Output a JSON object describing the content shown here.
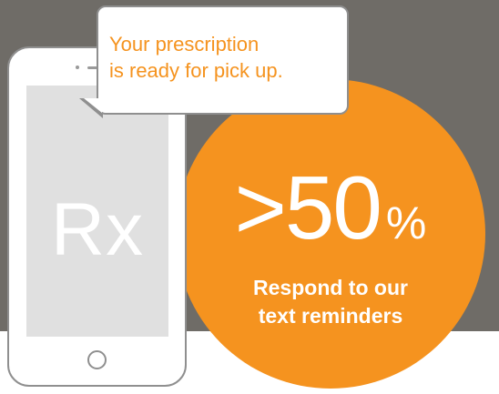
{
  "colors": {
    "background_dark": "#6f6c67",
    "accent_orange": "#f5931f",
    "phone_screen": "#e0e0e0",
    "outline_gray": "#8f8f8f"
  },
  "phone": {
    "screen_label": "Rx"
  },
  "bubble": {
    "line1": "Your prescription",
    "line2": "is ready for pick up."
  },
  "stat": {
    "number": ">50",
    "unit": "%",
    "caption_line1": "Respond to our",
    "caption_line2": "text reminders"
  },
  "icons": {
    "phone": "smartphone-icon",
    "home_button": "home-button-icon"
  }
}
